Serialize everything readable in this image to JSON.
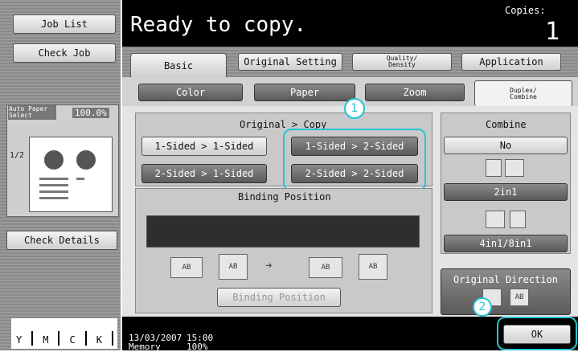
{
  "left": {
    "job_list": "Job List",
    "check_job": "Check Job",
    "paper_label": "Auto Paper\nSelect",
    "zoom_value": "100.0%",
    "copies_mark": "1/2",
    "check_details": "Check Details",
    "toners": [
      "Y",
      "M",
      "C",
      "K"
    ]
  },
  "header": {
    "status": "Ready to copy.",
    "copies_label": "Copies:",
    "copies_value": "1"
  },
  "tabs": {
    "basic": "Basic",
    "original_setting": "Original Setting",
    "quality_density": "Quality/\nDensity",
    "application": "Application"
  },
  "subtabs": {
    "color": "Color",
    "paper": "Paper",
    "zoom": "Zoom",
    "duplex": "Duplex/\nCombine"
  },
  "duplex": {
    "title": "Original > Copy",
    "one_one": "1-Sided > 1-Sided",
    "one_two": "1-Sided > 2-Sided",
    "two_one": "2-Sided > 1-Sided",
    "two_two": "2-Sided > 2-Sided",
    "binding_title": "Binding Position",
    "binding_button": "Binding Position",
    "icon_ab": "AB"
  },
  "combine": {
    "title": "Combine",
    "no": "No",
    "two_in_one": "2in1",
    "four_eight": "4in1/8in1",
    "original_direction": "Original Direction"
  },
  "footer": {
    "date": "13/03/2007",
    "time": "15:00",
    "memory_label": "Memory",
    "memory_value": "100%",
    "ok": "OK"
  },
  "callouts": {
    "one": "1",
    "two": "2"
  }
}
